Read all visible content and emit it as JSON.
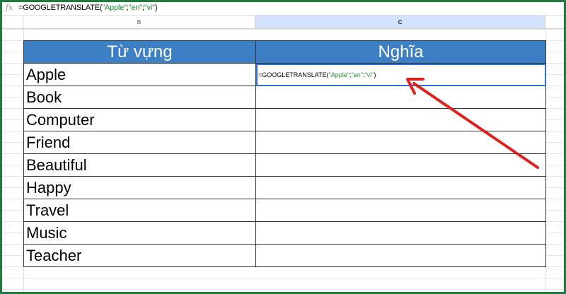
{
  "formula_bar": {
    "icon": "fx",
    "prefix": "=GOOGLETRANSLATE(",
    "a1": "\"Apple\"",
    "sep1": ";",
    "a2": "\"en\"",
    "sep2": ";",
    "a3": "\"vi\"",
    "suffix": ")"
  },
  "columns": [
    "B",
    "C"
  ],
  "table": {
    "headers": [
      "Từ vựng",
      "Nghĩa"
    ],
    "words": [
      "Apple",
      "Book",
      "Computer",
      "Friend",
      "Beautiful",
      "Happy",
      "Travel",
      "Music",
      "Teacher"
    ]
  },
  "colors": {
    "header": "#3d7fc4",
    "arrow": "#e0201c",
    "selection": "#2f6fd6",
    "frame": "#1e7a3c"
  }
}
